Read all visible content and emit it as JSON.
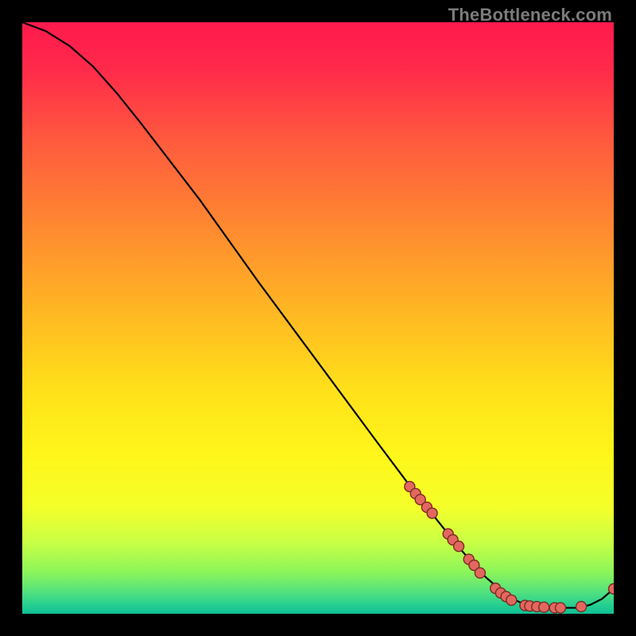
{
  "watermark": "TheBottleneck.com",
  "chart_data": {
    "type": "line",
    "title": "",
    "xlabel": "",
    "ylabel": "",
    "xlim": [
      0,
      100
    ],
    "ylim": [
      0,
      100
    ],
    "series": [
      {
        "name": "curve",
        "x": [
          0,
          4,
          8,
          12,
          16,
          20,
          30,
          40,
          50,
          60,
          66,
          70,
          74,
          78,
          82,
          84,
          86,
          88,
          90,
          92,
          94,
          96,
          98,
          100
        ],
        "y": [
          100,
          98.5,
          96,
          92.5,
          88,
          83,
          70,
          56,
          42.5,
          29,
          21,
          16,
          11,
          6.5,
          3,
          2,
          1.3,
          1,
          1,
          1,
          1,
          1.5,
          2.5,
          4.2
        ]
      }
    ],
    "markers": [
      {
        "x": 65.5,
        "y": 21.5
      },
      {
        "x": 66.5,
        "y": 20.3
      },
      {
        "x": 67.3,
        "y": 19.3
      },
      {
        "x": 68.4,
        "y": 18.0
      },
      {
        "x": 69.3,
        "y": 17.0
      },
      {
        "x": 72.0,
        "y": 13.5
      },
      {
        "x": 72.8,
        "y": 12.5
      },
      {
        "x": 73.8,
        "y": 11.4
      },
      {
        "x": 75.5,
        "y": 9.2
      },
      {
        "x": 76.4,
        "y": 8.2
      },
      {
        "x": 77.4,
        "y": 6.9
      },
      {
        "x": 80.0,
        "y": 4.3
      },
      {
        "x": 80.9,
        "y": 3.5
      },
      {
        "x": 81.8,
        "y": 2.9
      },
      {
        "x": 82.7,
        "y": 2.3
      },
      {
        "x": 85.0,
        "y": 1.4
      },
      {
        "x": 85.8,
        "y": 1.3
      },
      {
        "x": 87.0,
        "y": 1.2
      },
      {
        "x": 88.2,
        "y": 1.1
      },
      {
        "x": 90.0,
        "y": 1.0
      },
      {
        "x": 91.0,
        "y": 1.0
      },
      {
        "x": 94.5,
        "y": 1.2
      },
      {
        "x": 100.0,
        "y": 4.2
      }
    ],
    "gradient_stops": [
      {
        "offset": 0.0,
        "color": "#ff1a4d"
      },
      {
        "offset": 0.08,
        "color": "#ff2a4a"
      },
      {
        "offset": 0.2,
        "color": "#ff5a3e"
      },
      {
        "offset": 0.35,
        "color": "#ff8a30"
      },
      {
        "offset": 0.5,
        "color": "#ffbb22"
      },
      {
        "offset": 0.62,
        "color": "#ffe01a"
      },
      {
        "offset": 0.73,
        "color": "#fff61a"
      },
      {
        "offset": 0.82,
        "color": "#f4ff2a"
      },
      {
        "offset": 0.88,
        "color": "#c8ff45"
      },
      {
        "offset": 0.93,
        "color": "#8cf55a"
      },
      {
        "offset": 0.965,
        "color": "#4fe080"
      },
      {
        "offset": 0.985,
        "color": "#26cf90"
      },
      {
        "offset": 1.0,
        "color": "#10c095"
      }
    ],
    "marker_style": {
      "fill": "#e2685f",
      "stroke": "#7b2a24",
      "r": 6.5
    }
  }
}
